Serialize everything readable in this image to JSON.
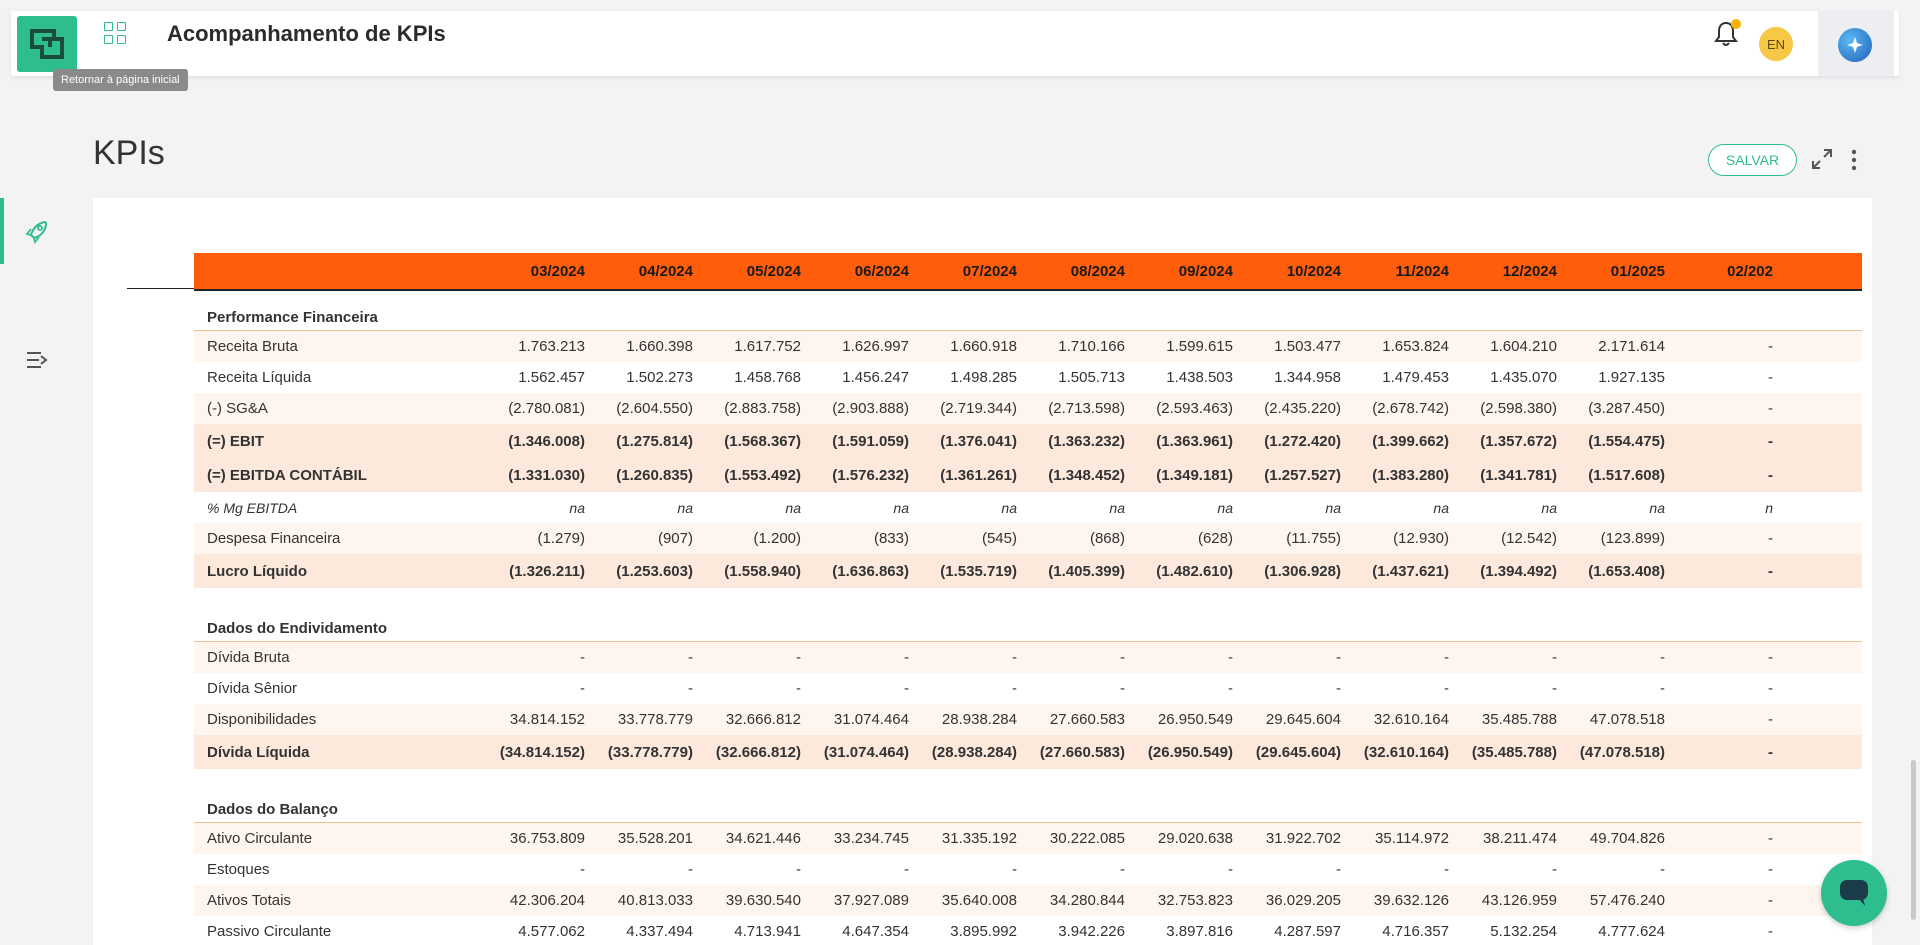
{
  "header": {
    "app_title": "Acompanhamento de KPIs",
    "tooltip": "Retornar à página inicial",
    "language": "EN"
  },
  "page": {
    "title": "KPIs",
    "save_label": "SALVAR"
  },
  "colors": {
    "accent": "#2ebd8f",
    "table_header": "#ff5c0b",
    "row_highlight": "#fde9dc"
  },
  "table": {
    "columns": [
      "03/2024",
      "04/2024",
      "05/2024",
      "06/2024",
      "07/2024",
      "08/2024",
      "09/2024",
      "10/2024",
      "11/2024",
      "12/2024",
      "01/2025",
      "02/202"
    ],
    "sections": [
      {
        "title": "Performance Financeira",
        "rows": [
          {
            "label": "Receita Bruta",
            "style": "alt",
            "values": [
              "1.763.213",
              "1.660.398",
              "1.617.752",
              "1.626.997",
              "1.660.918",
              "1.710.166",
              "1.599.615",
              "1.503.477",
              "1.653.824",
              "1.604.210",
              "2.171.614",
              "-"
            ]
          },
          {
            "label": "Receita Líquida",
            "style": "normal",
            "values": [
              "1.562.457",
              "1.502.273",
              "1.458.768",
              "1.456.247",
              "1.498.285",
              "1.505.713",
              "1.438.503",
              "1.344.958",
              "1.479.453",
              "1.435.070",
              "1.927.135",
              "-"
            ]
          },
          {
            "label": "(-) SG&A",
            "style": "alt",
            "values": [
              "(2.780.081)",
              "(2.604.550)",
              "(2.883.758)",
              "(2.903.888)",
              "(2.719.344)",
              "(2.713.598)",
              "(2.593.463)",
              "(2.435.220)",
              "(2.678.742)",
              "(2.598.380)",
              "(3.287.450)",
              "-"
            ]
          },
          {
            "label": "(=) EBIT",
            "style": "bold",
            "values": [
              "(1.346.008)",
              "(1.275.814)",
              "(1.568.367)",
              "(1.591.059)",
              "(1.376.041)",
              "(1.363.232)",
              "(1.363.961)",
              "(1.272.420)",
              "(1.399.662)",
              "(1.357.672)",
              "(1.554.475)",
              "-"
            ]
          },
          {
            "label": "(=) EBITDA CONTÁBIL",
            "style": "bold",
            "values": [
              "(1.331.030)",
              "(1.260.835)",
              "(1.553.492)",
              "(1.576.232)",
              "(1.361.261)",
              "(1.348.452)",
              "(1.349.181)",
              "(1.257.527)",
              "(1.383.280)",
              "(1.341.781)",
              "(1.517.608)",
              "-"
            ]
          },
          {
            "label": "% Mg EBITDA",
            "style": "italic",
            "values": [
              "na",
              "na",
              "na",
              "na",
              "na",
              "na",
              "na",
              "na",
              "na",
              "na",
              "na",
              "n"
            ]
          },
          {
            "label": "Despesa Financeira",
            "style": "alt",
            "values": [
              "(1.279)",
              "(907)",
              "(1.200)",
              "(833)",
              "(545)",
              "(868)",
              "(628)",
              "(11.755)",
              "(12.930)",
              "(12.542)",
              "(123.899)",
              "-"
            ]
          },
          {
            "label": "Lucro Líquido",
            "style": "bold",
            "values": [
              "(1.326.211)",
              "(1.253.603)",
              "(1.558.940)",
              "(1.636.863)",
              "(1.535.719)",
              "(1.405.399)",
              "(1.482.610)",
              "(1.306.928)",
              "(1.437.621)",
              "(1.394.492)",
              "(1.653.408)",
              "-"
            ]
          }
        ]
      },
      {
        "title": "Dados do Endividamento",
        "rows": [
          {
            "label": "Dívida Bruta",
            "style": "alt",
            "values": [
              "-",
              "-",
              "-",
              "-",
              "-",
              "-",
              "-",
              "-",
              "-",
              "-",
              "-",
              "-"
            ]
          },
          {
            "label": "Dívida Sênior",
            "style": "normal",
            "values": [
              "-",
              "-",
              "-",
              "-",
              "-",
              "-",
              "-",
              "-",
              "-",
              "-",
              "-",
              "-"
            ]
          },
          {
            "label": "Disponibilidades",
            "style": "alt",
            "values": [
              "34.814.152",
              "33.778.779",
              "32.666.812",
              "31.074.464",
              "28.938.284",
              "27.660.583",
              "26.950.549",
              "29.645.604",
              "32.610.164",
              "35.485.788",
              "47.078.518",
              "-"
            ]
          },
          {
            "label": "Dívida Líquida",
            "style": "bold",
            "values": [
              "(34.814.152)",
              "(33.778.779)",
              "(32.666.812)",
              "(31.074.464)",
              "(28.938.284)",
              "(27.660.583)",
              "(26.950.549)",
              "(29.645.604)",
              "(32.610.164)",
              "(35.485.788)",
              "(47.078.518)",
              "-"
            ]
          }
        ]
      },
      {
        "title": "Dados do Balanço",
        "rows": [
          {
            "label": "Ativo Circulante",
            "style": "alt",
            "values": [
              "36.753.809",
              "35.528.201",
              "34.621.446",
              "33.234.745",
              "31.335.192",
              "30.222.085",
              "29.020.638",
              "31.922.702",
              "35.114.972",
              "38.211.474",
              "49.704.826",
              "-"
            ]
          },
          {
            "label": "Estoques",
            "style": "normal",
            "values": [
              "-",
              "-",
              "-",
              "-",
              "-",
              "-",
              "-",
              "-",
              "-",
              "-",
              "-",
              "-"
            ]
          },
          {
            "label": "Ativos Totais",
            "style": "alt",
            "values": [
              "42.306.204",
              "40.813.033",
              "39.630.540",
              "37.927.089",
              "35.640.008",
              "34.280.844",
              "32.753.823",
              "36.029.205",
              "39.632.126",
              "43.126.959",
              "57.476.240",
              "-"
            ]
          },
          {
            "label": "Passivo Circulante",
            "style": "normal",
            "values": [
              "4.577.062",
              "4.337.494",
              "4.713.941",
              "4.647.354",
              "3.895.992",
              "3.942.226",
              "3.897.816",
              "4.287.597",
              "4.716.357",
              "5.132.254",
              "4.777.624",
              "-"
            ]
          }
        ]
      }
    ]
  }
}
